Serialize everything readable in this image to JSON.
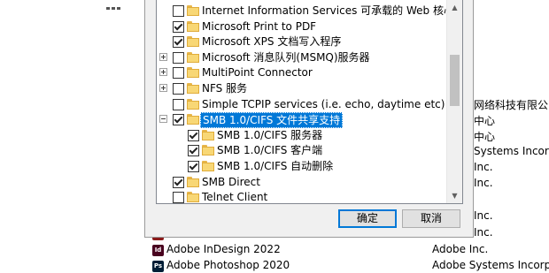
{
  "background": {
    "right_column_texts": [
      "网络科技有限公司",
      "中心",
      "中心",
      "Systems Incorpora",
      "Inc.",
      "Inc.",
      "Inc.",
      "Inc."
    ],
    "programs": [
      {
        "name": "Adobe InDesign 2022",
        "publisher": "Adobe Inc.",
        "icon": "indesign-icon",
        "icon_text": "Id",
        "icon_color": "#49021f"
      },
      {
        "name": "Adobe Photoshop 2020",
        "publisher": "Adobe Systems Incorpora",
        "icon": "photoshop-icon",
        "icon_text": "Ps",
        "icon_color": "#001e36"
      }
    ]
  },
  "dialog": {
    "features": [
      {
        "label": "Internet Information Services 可承载的 Web 核心",
        "checked": false,
        "expander": "none",
        "level": 0
      },
      {
        "label": "Microsoft Print to PDF",
        "checked": true,
        "expander": "none",
        "level": 0
      },
      {
        "label": "Microsoft XPS 文档写入程序",
        "checked": true,
        "expander": "none",
        "level": 0
      },
      {
        "label": "Microsoft 消息队列(MSMQ)服务器",
        "checked": false,
        "expander": "plus",
        "level": 0
      },
      {
        "label": "MultiPoint Connector",
        "checked": false,
        "expander": "plus",
        "level": 0
      },
      {
        "label": "NFS 服务",
        "checked": false,
        "expander": "plus",
        "level": 0
      },
      {
        "label": "Simple TCPIP services (i.e. echo, daytime etc)",
        "checked": false,
        "expander": "none",
        "level": 0
      },
      {
        "label": "SMB 1.0/CIFS 文件共享支持",
        "checked": true,
        "expander": "minus",
        "level": 0,
        "selected": true
      },
      {
        "label": "SMB 1.0/CIFS 服务器",
        "checked": true,
        "expander": "none",
        "level": 1
      },
      {
        "label": "SMB 1.0/CIFS 客户端",
        "checked": true,
        "expander": "none",
        "level": 1
      },
      {
        "label": "SMB 1.0/CIFS 自动删除",
        "checked": true,
        "expander": "none",
        "level": 1
      },
      {
        "label": "SMB Direct",
        "checked": true,
        "expander": "none",
        "level": 0
      },
      {
        "label": "Telnet Client",
        "checked": false,
        "expander": "none",
        "level": 0
      }
    ],
    "ok_label": "确定",
    "cancel_label": "取消",
    "colors": {
      "selection": "#0078d7",
      "folder": "#f8d775",
      "default_border": "#0078d7"
    }
  }
}
